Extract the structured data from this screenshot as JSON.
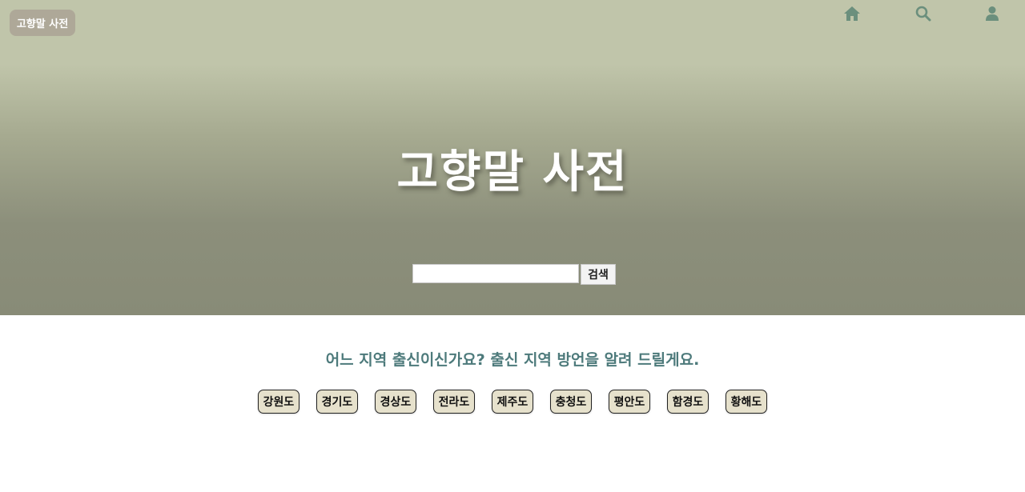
{
  "header": {
    "logo_label": "고향말 사전",
    "nav": [
      {
        "icon": "home-icon",
        "color": "#6b8f7d"
      },
      {
        "icon": "search-icon",
        "color": "#6b8f7d"
      },
      {
        "icon": "user-icon",
        "color": "#6b8f7d"
      }
    ]
  },
  "hero": {
    "title": "고향말 사전",
    "search": {
      "value": "",
      "placeholder": "",
      "button_label": "검색"
    }
  },
  "main": {
    "question": "어느 지역 출신이신가요? 출신 지역 방언을 알려 드릴게요.",
    "regions": [
      "강원도",
      "경기도",
      "경상도",
      "전라도",
      "제주도",
      "충청도",
      "평안도",
      "함경도",
      "황해도"
    ]
  },
  "colors": {
    "hero_top": "#c0c5aa",
    "hero_bottom": "#888b77",
    "accent_text": "#4d7a7b",
    "region_button_bg": "#e6e1cc",
    "logo_bg": "#aea898"
  }
}
